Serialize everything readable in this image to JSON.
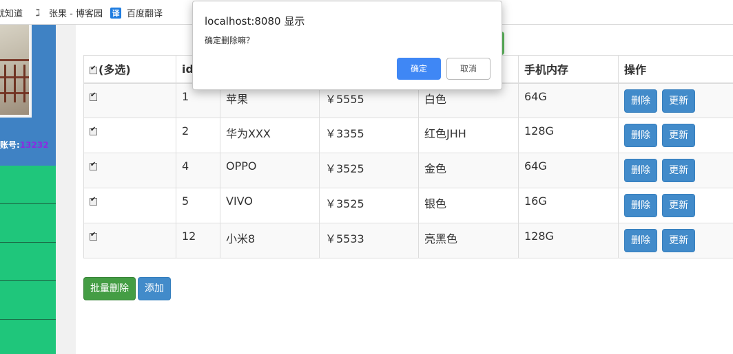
{
  "bookmarks": [
    {
      "label": "就知道",
      "icon": "bookmark-icon"
    },
    {
      "label": "张果 - 博客园",
      "icon": "zhangguo-logo-icon"
    },
    {
      "label": "百度翻译",
      "icon": "baidu-translate-icon",
      "glyph": "译"
    }
  ],
  "sidebar": {
    "account_label": "账号:",
    "account_number": "13232"
  },
  "table": {
    "headers": [
      "(多选)",
      "id",
      "",
      "",
      "",
      "手机内存",
      "操作"
    ],
    "rows": [
      {
        "checked": true,
        "id": "1",
        "name": "苹果",
        "price": "￥5555",
        "color": "白色",
        "memory": "64G"
      },
      {
        "checked": true,
        "id": "2",
        "name": "华为XXX",
        "price": "￥3355",
        "color": "红色JHH",
        "memory": "128G"
      },
      {
        "checked": true,
        "id": "4",
        "name": "OPPO",
        "price": "￥3525",
        "color": "金色",
        "memory": "64G"
      },
      {
        "checked": true,
        "id": "5",
        "name": "VIVO",
        "price": "￥3525",
        "color": "银色",
        "memory": "16G"
      },
      {
        "checked": true,
        "id": "12",
        "name": "小米8",
        "price": "￥5533",
        "color": "亮黑色",
        "memory": "128G"
      }
    ],
    "delete_label": "删除",
    "update_label": "更新"
  },
  "actions": {
    "batch_delete_label": "批量删除",
    "add_label": "添加"
  },
  "dialog": {
    "title": "localhost:8080 显示",
    "message": "确定删除嘛？",
    "ok_label": "确定",
    "cancel_label": "取消"
  },
  "colors": {
    "primary": "#428bca",
    "success": "#449d44",
    "sidebar_green": "#1fc67b",
    "profile_blue": "#3f82c4",
    "dialog_ok": "#3f87f5"
  }
}
